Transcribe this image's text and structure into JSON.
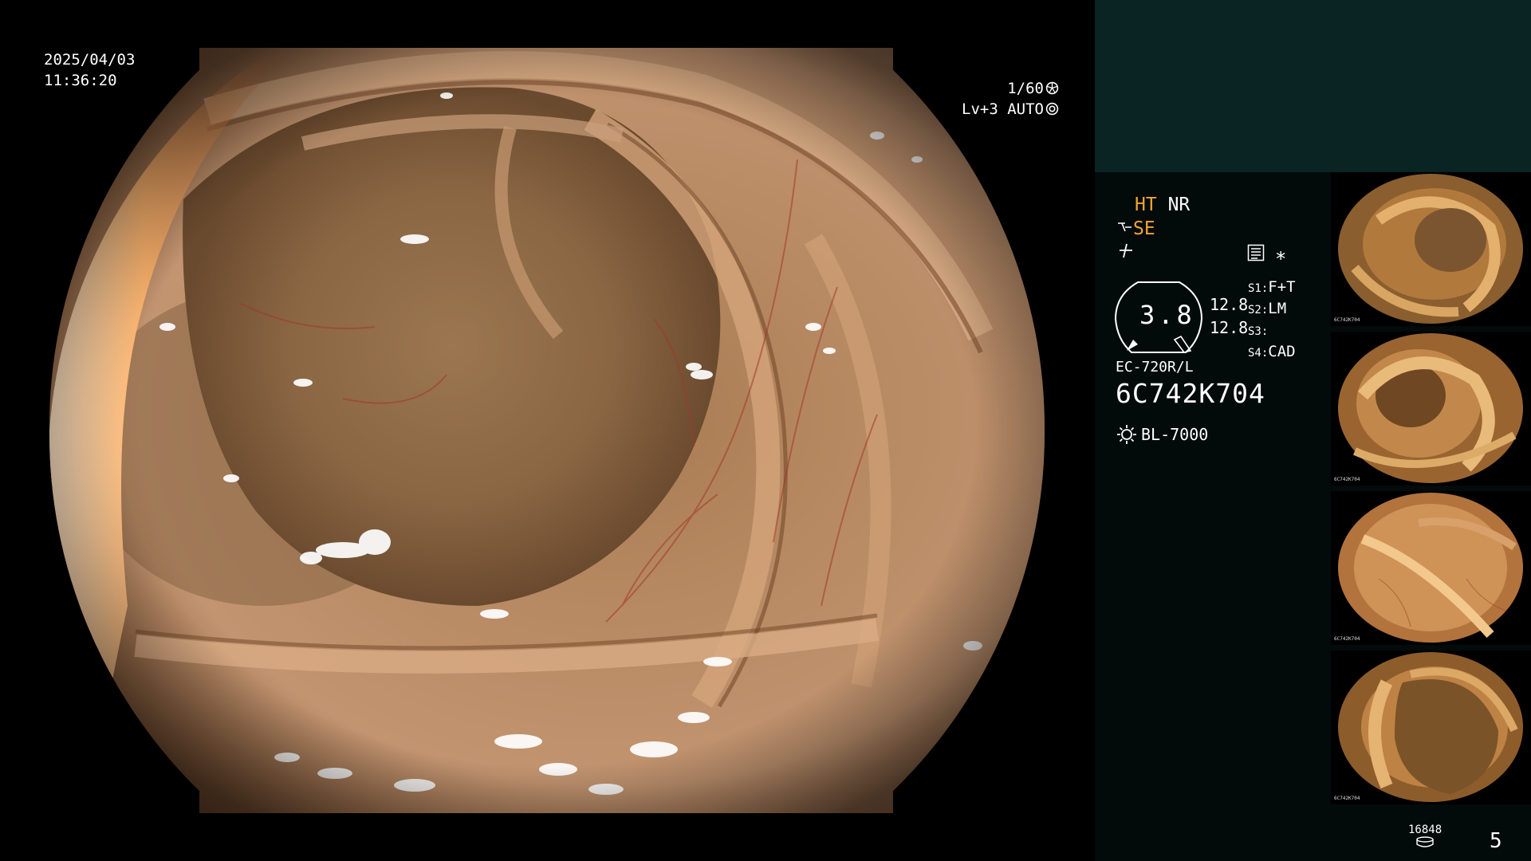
{
  "overlay": {
    "date": "2025/04/03",
    "time": "11:36:20",
    "shutter_speed": "1/60",
    "enhancement_level": "Lv+3",
    "iris_mode": "AUTO"
  },
  "panel": {
    "ht_label": "HT",
    "nr_label": "NR",
    "se_label": "SE",
    "dial_value": "3.8",
    "side_value_1": "12.8",
    "side_value_2": "12.8",
    "switches": [
      {
        "key": "S1:",
        "value": "F+T"
      },
      {
        "key": "S2:",
        "value": "LM"
      },
      {
        "key": "S3:",
        "value": ""
      },
      {
        "key": "S4:",
        "value": "CAD"
      }
    ],
    "scope_model": "EC-720R/L",
    "scope_serial": "6C742K704",
    "light_source": "BL-7000",
    "image_counter": "16848",
    "page_number": "5"
  },
  "colors": {
    "amber": "#f2a431",
    "panel_top": "#0a2323",
    "panel_bg": "#030a0a"
  },
  "thumbnails": [
    {
      "serial": "6C742K704"
    },
    {
      "serial": "6C742K704"
    },
    {
      "serial": "6C742K704"
    },
    {
      "serial": "6C742K704"
    }
  ]
}
